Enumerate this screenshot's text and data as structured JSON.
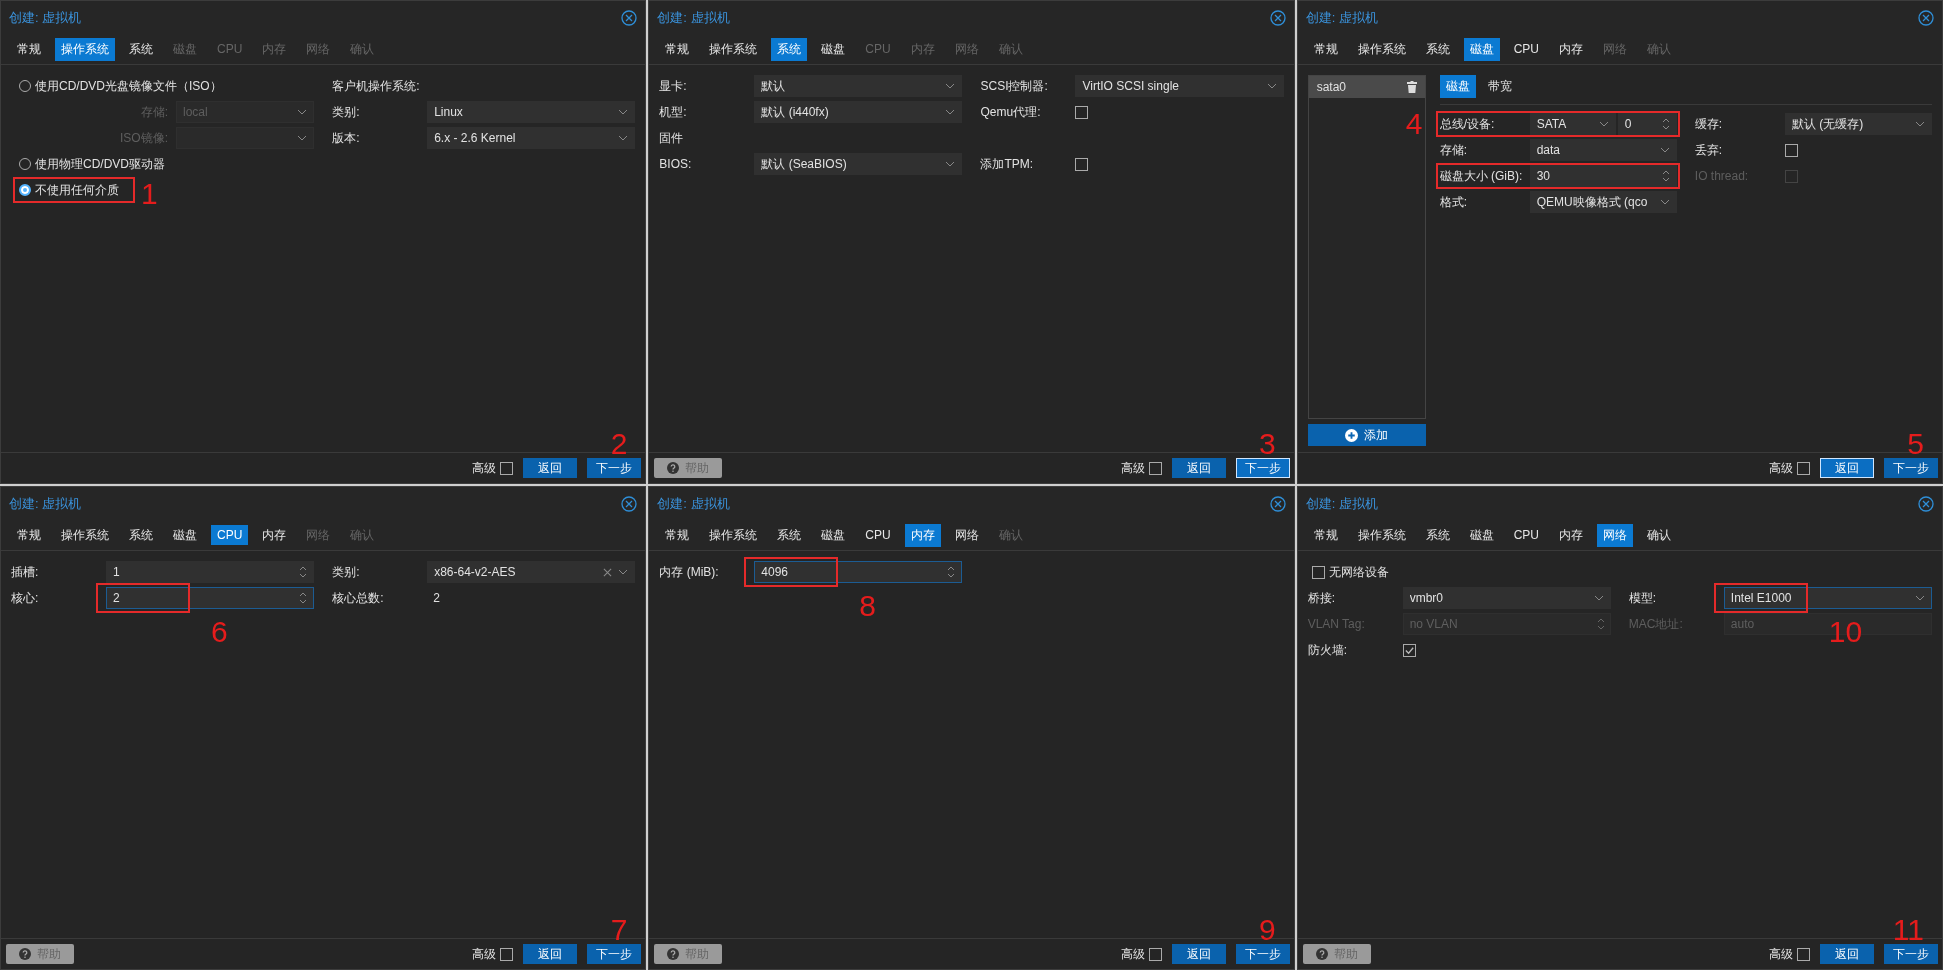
{
  "panels": [
    {
      "title": "创建: 虚拟机",
      "tabs": [
        {
          "label": "常规",
          "selected": false,
          "disabled": false
        },
        {
          "label": "操作系统",
          "selected": true,
          "disabled": false
        },
        {
          "label": "系统",
          "selected": false,
          "disabled": false
        },
        {
          "label": "磁盘",
          "selected": false,
          "disabled": true
        },
        {
          "label": "CPU",
          "selected": false,
          "disabled": true
        },
        {
          "label": "内存",
          "selected": false,
          "disabled": true
        },
        {
          "label": "网络",
          "selected": false,
          "disabled": true
        },
        {
          "label": "确认",
          "selected": false,
          "disabled": true
        }
      ],
      "rows": [
        [
          {
            "kind": "radio",
            "label": "使用CD/DVD光盘镜像文件（ISO）",
            "selected": false
          },
          {
            "kind": "heading",
            "label": "客户机操作系统:"
          }
        ],
        [
          {
            "kind": "indented_select",
            "label": "存储:",
            "value": "local",
            "disabled": true
          },
          {
            "kind": "select",
            "label": "类别:",
            "value": "Linux"
          }
        ],
        [
          {
            "kind": "indented_select",
            "label": "ISO镜像:",
            "disabled": true
          },
          {
            "kind": "select",
            "label": "版本:",
            "value": "6.x - 2.6 Kernel"
          }
        ],
        [
          {
            "kind": "radio",
            "label": "使用物理CD/DVD驱动器",
            "selected": false
          }
        ],
        [
          {
            "kind": "radio",
            "label": "不使用任何介质",
            "selected": true,
            "row_boxed": true,
            "note": "1"
          }
        ]
      ],
      "footer": {
        "advanced": {
          "label": "高级",
          "checked": false
        },
        "buttons": [
          {
            "label": "返回",
            "focused": false
          },
          {
            "label": "下一步",
            "focused": false
          }
        ],
        "note": "2"
      }
    },
    {
      "title": "创建: 虚拟机",
      "tabs": [
        {
          "label": "常规",
          "selected": false,
          "disabled": false
        },
        {
          "label": "操作系统",
          "selected": false,
          "disabled": false
        },
        {
          "label": "系统",
          "selected": true,
          "disabled": false
        },
        {
          "label": "磁盘",
          "selected": false,
          "disabled": false
        },
        {
          "label": "CPU",
          "selected": false,
          "disabled": true
        },
        {
          "label": "内存",
          "selected": false,
          "disabled": true
        },
        {
          "label": "网络",
          "selected": false,
          "disabled": true
        },
        {
          "label": "确认",
          "selected": false,
          "disabled": true
        }
      ],
      "rows": [
        [
          {
            "kind": "select",
            "label": "显卡:",
            "value": "默认"
          },
          {
            "kind": "select",
            "label": "SCSI控制器:",
            "value": "VirtIO SCSI single"
          }
        ],
        [
          {
            "kind": "select",
            "label": "机型:",
            "value": "默认 (i440fx)"
          },
          {
            "kind": "checkbox",
            "label": "Qemu代理:",
            "checked": false
          }
        ],
        [
          {
            "kind": "heading",
            "label": "固件"
          }
        ],
        [
          {
            "kind": "select",
            "label": "BIOS:",
            "value": "默认 (SeaBIOS)"
          },
          {
            "kind": "checkbox",
            "label": "添加TPM:",
            "checked": false
          }
        ]
      ],
      "footer": {
        "help": "帮助",
        "advanced": {
          "label": "高级",
          "checked": false
        },
        "buttons": [
          {
            "label": "返回",
            "focused": false
          },
          {
            "label": "下一步",
            "focused": true
          }
        ],
        "note": "3"
      }
    },
    {
      "title": "创建: 虚拟机",
      "tabs": [
        {
          "label": "常规",
          "selected": false,
          "disabled": false
        },
        {
          "label": "操作系统",
          "selected": false,
          "disabled": false
        },
        {
          "label": "系统",
          "selected": false,
          "disabled": false
        },
        {
          "label": "磁盘",
          "selected": true,
          "disabled": false
        },
        {
          "label": "CPU",
          "selected": false,
          "disabled": false
        },
        {
          "label": "内存",
          "selected": false,
          "disabled": false
        },
        {
          "label": "网络",
          "selected": false,
          "disabled": true
        },
        {
          "label": "确认",
          "selected": false,
          "disabled": true
        }
      ],
      "disk_list": {
        "items": [
          {
            "label": "sata0",
            "selected": true
          }
        ],
        "add_button": "添加"
      },
      "subtabs": [
        {
          "label": "磁盘",
          "selected": true
        },
        {
          "label": "带宽",
          "selected": false
        }
      ],
      "rows": [
        [
          {
            "kind": "bus",
            "label": "总线/设备:",
            "value": "SATA",
            "value2": "0",
            "row_boxed": true,
            "note": "4"
          },
          {
            "kind": "select",
            "label": "缓存:",
            "value": "默认 (无缓存)"
          }
        ],
        [
          {
            "kind": "select",
            "label": "存储:",
            "value": "data"
          },
          {
            "kind": "checkbox",
            "label": "丢弃:",
            "checked": false
          }
        ],
        [
          {
            "kind": "spinner",
            "label": "磁盘大小 (GiB):",
            "value": "30",
            "row_boxed": true
          },
          {
            "kind": "checkbox",
            "label": "IO thread:",
            "checked": false,
            "disabled": true
          }
        ],
        [
          {
            "kind": "select",
            "label": "格式:",
            "value": "QEMU映像格式 (qco"
          }
        ]
      ],
      "footer": {
        "advanced": {
          "label": "高级",
          "checked": false
        },
        "buttons": [
          {
            "label": "返回",
            "focused": true
          },
          {
            "label": "下一步",
            "focused": false
          }
        ],
        "note": "5"
      }
    },
    {
      "title": "创建: 虚拟机",
      "tabs": [
        {
          "label": "常规",
          "selected": false,
          "disabled": false
        },
        {
          "label": "操作系统",
          "selected": false,
          "disabled": false
        },
        {
          "label": "系统",
          "selected": false,
          "disabled": false
        },
        {
          "label": "磁盘",
          "selected": false,
          "disabled": false
        },
        {
          "label": "CPU",
          "selected": true,
          "disabled": false
        },
        {
          "label": "内存",
          "selected": false,
          "disabled": false
        },
        {
          "label": "网络",
          "selected": false,
          "disabled": true
        },
        {
          "label": "确认",
          "selected": false,
          "disabled": true
        }
      ],
      "rows": [
        [
          {
            "kind": "spinner",
            "label": "插槽:",
            "value": "1"
          },
          {
            "kind": "select",
            "label": "类别:",
            "value": "x86-64-v2-AES",
            "clearable": true
          }
        ],
        [
          {
            "kind": "spinner",
            "label": "核心:",
            "value": "2",
            "focused": true,
            "input_boxed": true,
            "note": "6"
          },
          {
            "kind": "static",
            "label": "核心总数:",
            "value": "2"
          }
        ]
      ],
      "footer": {
        "help": "帮助",
        "advanced": {
          "label": "高级",
          "checked": false
        },
        "buttons": [
          {
            "label": "返回",
            "focused": false
          },
          {
            "label": "下一步",
            "focused": false
          }
        ],
        "note": "7"
      }
    },
    {
      "title": "创建: 虚拟机",
      "tabs": [
        {
          "label": "常规",
          "selected": false,
          "disabled": false
        },
        {
          "label": "操作系统",
          "selected": false,
          "disabled": false
        },
        {
          "label": "系统",
          "selected": false,
          "disabled": false
        },
        {
          "label": "磁盘",
          "selected": false,
          "disabled": false
        },
        {
          "label": "CPU",
          "selected": false,
          "disabled": false
        },
        {
          "label": "内存",
          "selected": true,
          "disabled": false
        },
        {
          "label": "网络",
          "selected": false,
          "disabled": false
        },
        {
          "label": "确认",
          "selected": false,
          "disabled": true
        }
      ],
      "rows": [
        [
          {
            "kind": "spinner",
            "label": "内存 (MiB):",
            "value": "4096",
            "focused": true,
            "input_boxed": true,
            "note": "8"
          }
        ]
      ],
      "footer": {
        "help": "帮助",
        "advanced": {
          "label": "高级",
          "checked": false
        },
        "buttons": [
          {
            "label": "返回",
            "focused": false
          },
          {
            "label": "下一步",
            "focused": false
          }
        ],
        "note": "9"
      }
    },
    {
      "title": "创建: 虚拟机",
      "tabs": [
        {
          "label": "常规",
          "selected": false,
          "disabled": false
        },
        {
          "label": "操作系统",
          "selected": false,
          "disabled": false
        },
        {
          "label": "系统",
          "selected": false,
          "disabled": false
        },
        {
          "label": "磁盘",
          "selected": false,
          "disabled": false
        },
        {
          "label": "CPU",
          "selected": false,
          "disabled": false
        },
        {
          "label": "内存",
          "selected": false,
          "disabled": false
        },
        {
          "label": "网络",
          "selected": true,
          "disabled": false
        },
        {
          "label": "确认",
          "selected": false,
          "disabled": false
        }
      ],
      "rows": [
        [
          {
            "kind": "option_check",
            "label": "无网络设备",
            "checked": false
          }
        ],
        [
          {
            "kind": "select",
            "label": "桥接:",
            "value": "vmbr0"
          },
          {
            "kind": "select",
            "label": "模型:",
            "value": "Intel E1000",
            "focused": true,
            "input_boxed": true,
            "note": "10"
          }
        ],
        [
          {
            "kind": "spinner",
            "label": "VLAN Tag:",
            "placeholder": "no VLAN",
            "disabled": true
          },
          {
            "kind": "text",
            "label": "MAC地址:",
            "placeholder": "auto",
            "disabled": true
          }
        ],
        [
          {
            "kind": "checkbox",
            "label": "防火墙:",
            "checked": true
          }
        ]
      ],
      "footer": {
        "help": "帮助",
        "advanced": {
          "label": "高级",
          "checked": false
        },
        "buttons": [
          {
            "label": "返回",
            "focused": false
          },
          {
            "label": "下一步",
            "focused": false
          }
        ],
        "note": "11"
      }
    }
  ]
}
